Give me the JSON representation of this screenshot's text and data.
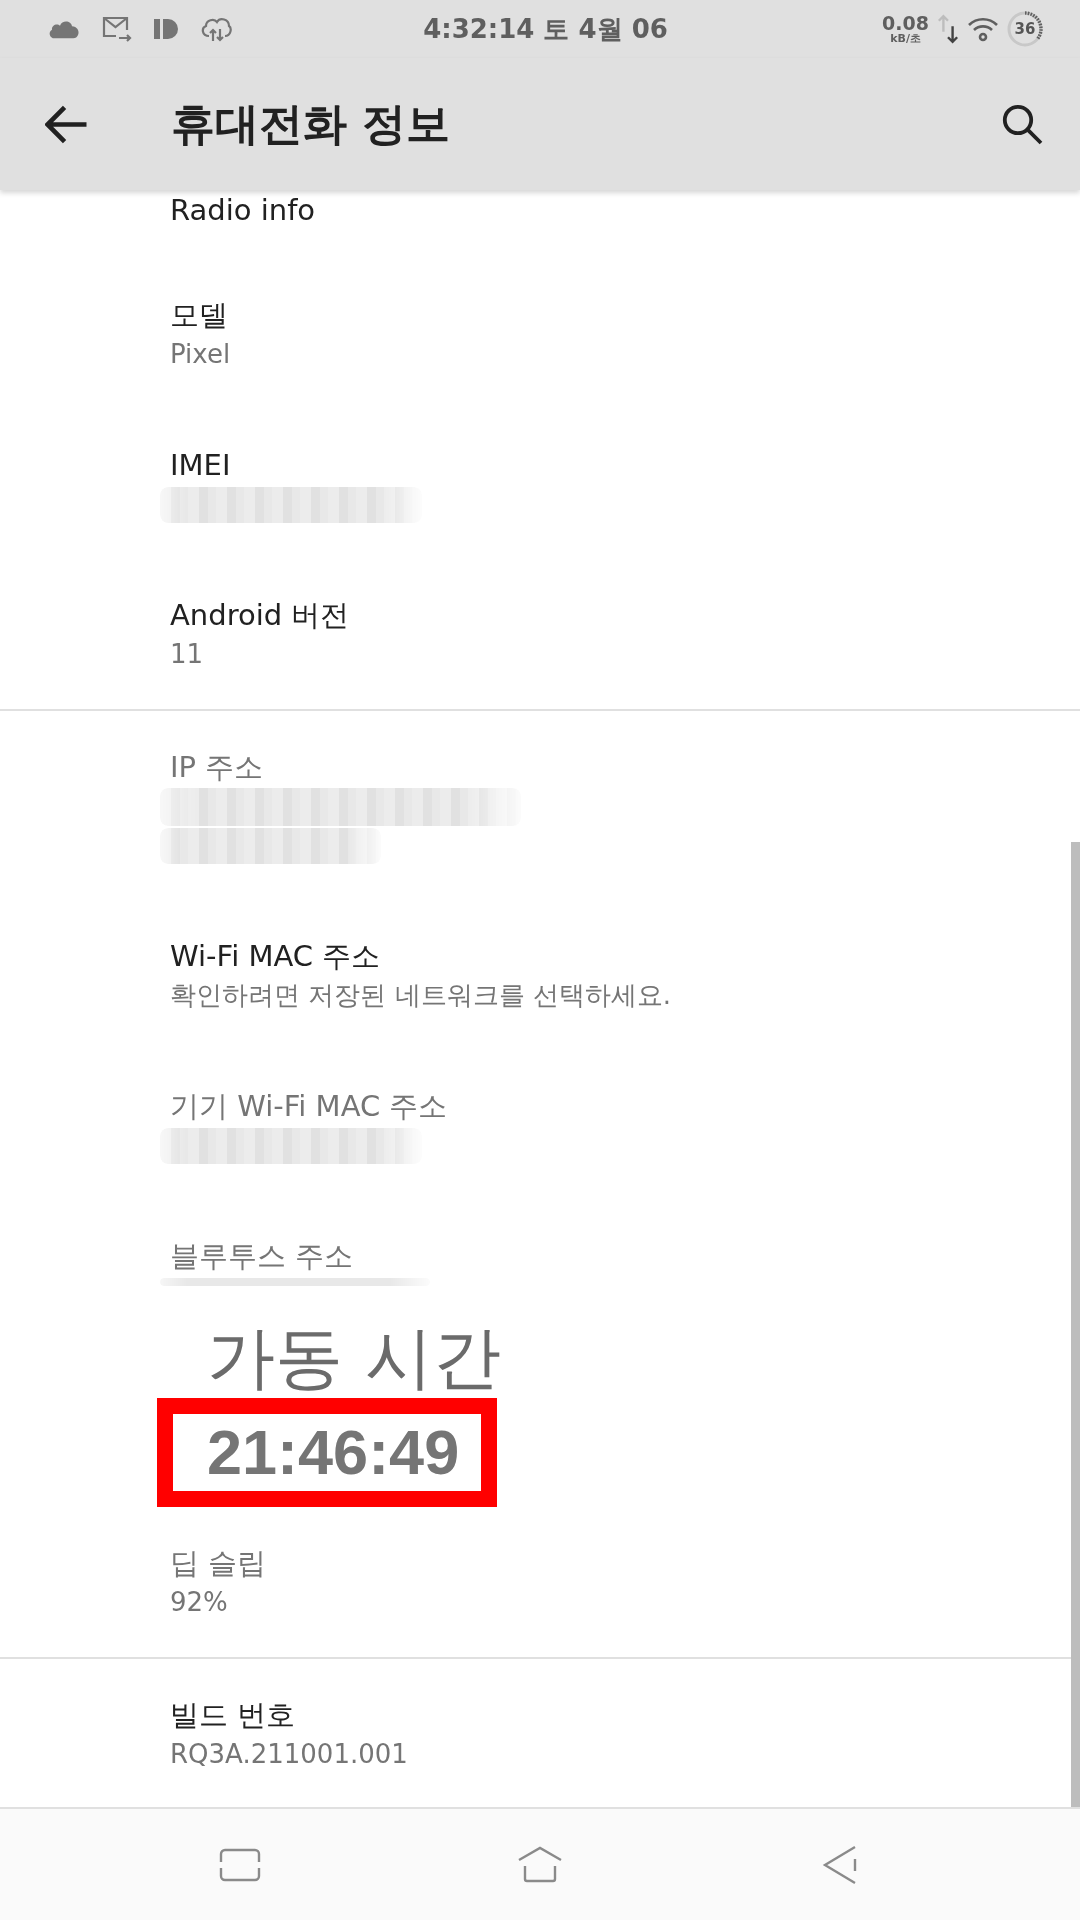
{
  "status_bar": {
    "time": "4:32:14 토 4월 06",
    "net_speed": "0.08",
    "net_unit": "kB/초",
    "battery": "36"
  },
  "app_bar": {
    "title": "휴대전화 정보"
  },
  "sections": [
    {
      "items": [
        {
          "kind": "entry",
          "title": "Radio info",
          "disabled": false
        },
        {
          "kind": "entry",
          "title": "모델",
          "value": "Pixel",
          "disabled": false
        },
        {
          "kind": "entry",
          "title": "IMEI",
          "disabled": false,
          "blur": {
            "kind": "single"
          }
        },
        {
          "kind": "entry",
          "title": "Android 버전",
          "value": "11",
          "disabled": false
        }
      ]
    },
    {
      "items": [
        {
          "kind": "entry",
          "title": "IP 주소",
          "disabled": true,
          "blur": {
            "kind": "double"
          }
        },
        {
          "kind": "entry",
          "title": "Wi-Fi MAC 주소",
          "value": "확인하려면 저장된 네트워크를 선택하세요.",
          "disabled": false
        },
        {
          "kind": "entry",
          "title": "기기 Wi-Fi MAC 주소",
          "disabled": true,
          "blur": {
            "kind": "single"
          }
        },
        {
          "kind": "entry",
          "title": "블루투스 주소",
          "disabled": true,
          "blur": {
            "kind": "strip"
          }
        },
        {
          "kind": "callout",
          "title": "가동 시간",
          "value": "21:46:49"
        },
        {
          "kind": "entry",
          "title": "딥 슬립",
          "value": "92%",
          "disabled": true
        }
      ]
    },
    {
      "items": [
        {
          "kind": "entry",
          "title": "빌드 번호",
          "value": "RQ3A.211001.001",
          "disabled": false
        }
      ]
    }
  ]
}
